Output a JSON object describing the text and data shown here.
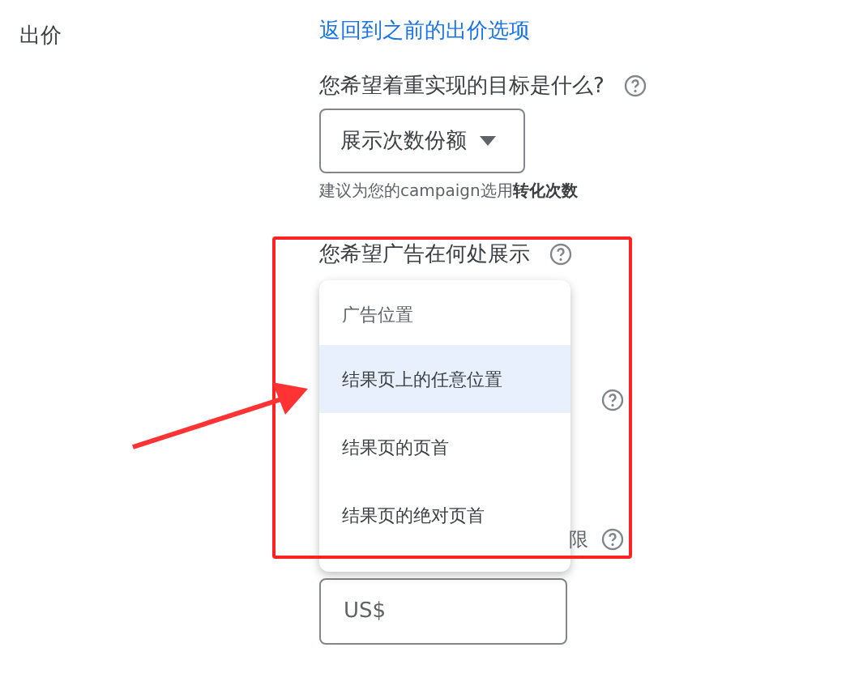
{
  "section_label": "出价",
  "back_link": "返回到之前的出价选项",
  "goal": {
    "question": "您希望着重实现的目标是什么?",
    "value": "展示次数份额",
    "hint": "建议为您的campaign选用**转化次数**"
  },
  "placement": {
    "question": "您希望广告在何处展示",
    "menu": {
      "header": "广告位置",
      "options": [
        {
          "label": "结果页上的任意位置",
          "selected": true
        },
        {
          "label": "结果页的页首",
          "selected": false
        },
        {
          "label": "结果页的绝对页首",
          "selected": false
        }
      ]
    }
  },
  "hidden_label_fragment": "限",
  "amount": {
    "placeholder": "US$"
  }
}
